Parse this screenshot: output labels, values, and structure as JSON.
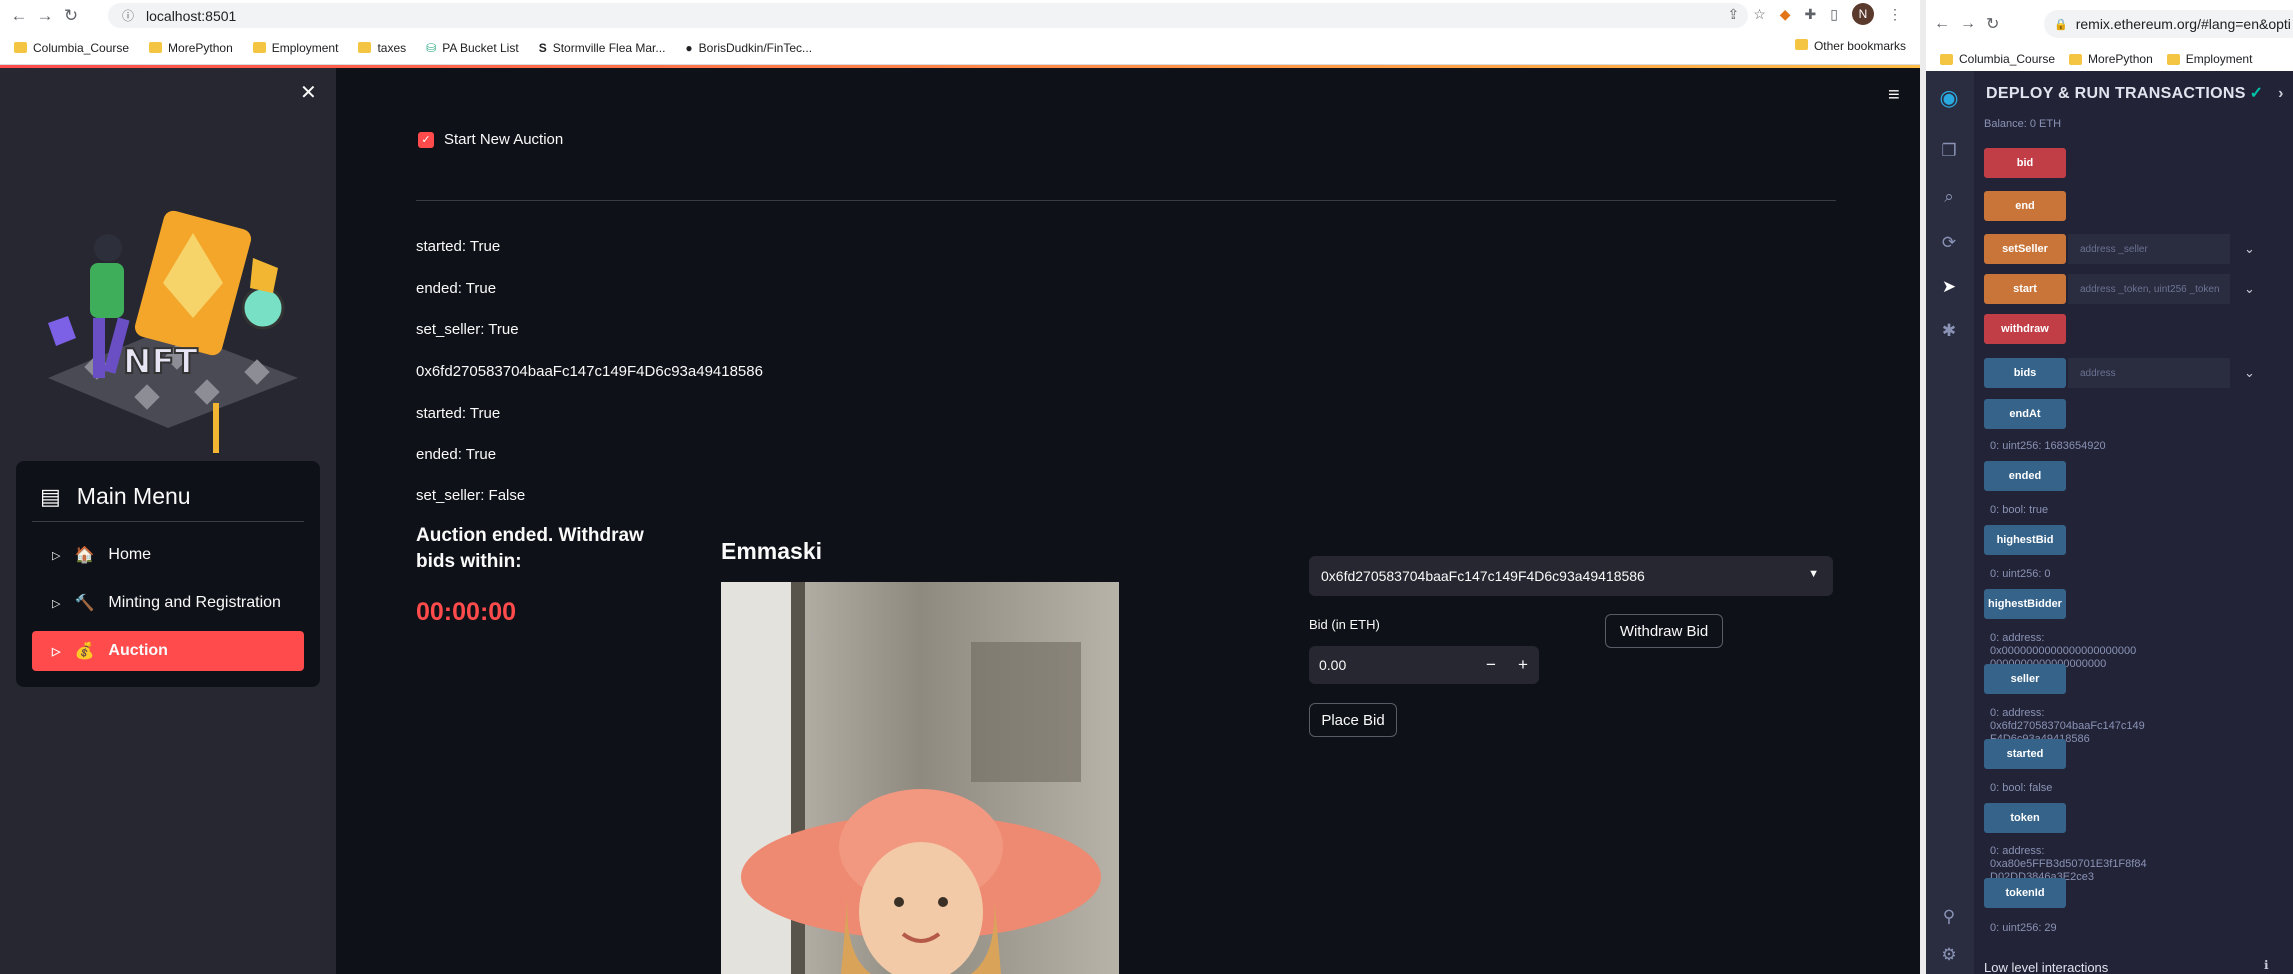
{
  "left_browser": {
    "url": "localhost:8501",
    "bookmarks": [
      "Columbia_Course",
      "MorePython",
      "Employment",
      "taxes",
      "PA Bucket List",
      "Stormville Flea Mar...",
      "BorisDudkin/FinTec..."
    ],
    "other_bookmarks": "Other bookmarks",
    "profile_initial": "N"
  },
  "sidebar": {
    "menu_title": "Main Menu",
    "items": [
      {
        "label": "Home",
        "emoji": "🏠",
        "active": false
      },
      {
        "label": "Minting and Registration",
        "emoji": "🔨",
        "active": true
      },
      {
        "label": "Auction",
        "emoji": "💰",
        "active": true
      }
    ]
  },
  "main": {
    "checkbox_label": "Start New Auction",
    "status_lines": [
      "started: True",
      "ended: True",
      "set_seller: True",
      "0x6fd270583704baaFc147c149F4D6c93a49418586",
      "started: True",
      "ended: True",
      "set_seller: False"
    ],
    "ended_message": "Auction ended. Withdraw bids within:",
    "timer": "00:00:00",
    "nft_name": "Emmaski",
    "selected_account": "0x6fd270583704baaFc147c149F4D6c93a49418586",
    "bid_label": "Bid (in ETH)",
    "bid_value": "0.00",
    "place_bid": "Place Bid",
    "withdraw_bid": "Withdraw Bid"
  },
  "right_browser": {
    "url": "remix.ethereum.org/#lang=en&opti",
    "bookmarks": [
      "Columbia_Course",
      "MorePython",
      "Employment"
    ],
    "panel_title": "DEPLOY & RUN TRANSACTIONS",
    "balance": "Balance: 0 ETH",
    "functions": [
      {
        "name": "bid",
        "color": "red"
      },
      {
        "name": "end",
        "color": "orange"
      },
      {
        "name": "setSeller",
        "color": "orange",
        "placeholder": "address _seller"
      },
      {
        "name": "start",
        "color": "orange",
        "placeholder": "address _token, uint256 _token"
      },
      {
        "name": "withdraw",
        "color": "red"
      },
      {
        "name": "bids",
        "color": "blue",
        "placeholder": "address"
      },
      {
        "name": "endAt",
        "color": "blue",
        "output": "0: uint256: 1683654920"
      },
      {
        "name": "ended",
        "color": "blue",
        "output": "0: bool: true"
      },
      {
        "name": "highestBid",
        "color": "blue",
        "output": "0: uint256: 0"
      },
      {
        "name": "highestBidder",
        "color": "blue",
        "output": "0: address: 0x0000000000000000000000 0000000000000000000"
      },
      {
        "name": "seller",
        "color": "blue",
        "output": "0: address: 0x6fd270583704baaFc147c149 F4D6c93a49418586"
      },
      {
        "name": "started",
        "color": "blue",
        "output": "0: bool: false"
      },
      {
        "name": "token",
        "color": "blue",
        "output": "0: address: 0xa80e5FFB3d50701E3f1F8f84 D02DD3846a3E2ce3"
      },
      {
        "name": "tokenId",
        "color": "blue",
        "output": "0: uint256: 29"
      }
    ],
    "low_level": "Low level interactions"
  },
  "colors": {
    "accent": "#ff4b4b",
    "bg": "#0e1117",
    "sidebar": "#262730"
  }
}
